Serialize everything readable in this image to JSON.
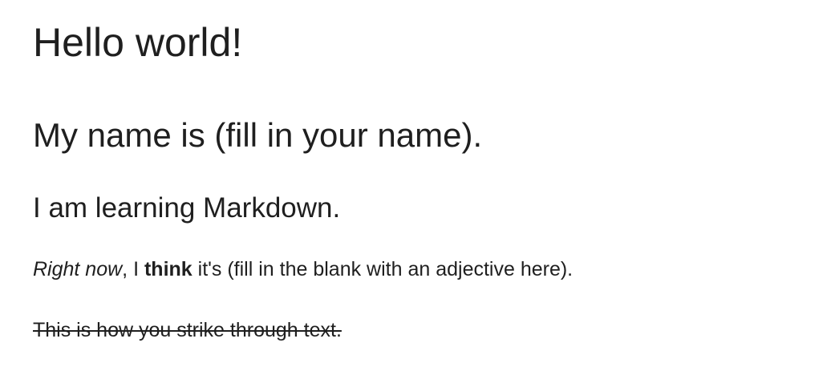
{
  "document": {
    "heading1": "Hello world!",
    "heading2": "My name is (fill in your name).",
    "heading3": "I am learning Markdown.",
    "paragraph1": {
      "italic": "Right now",
      "after_italic": ", I ",
      "bold": "think",
      "rest": " it's (fill in the blank with an adjective here)."
    },
    "paragraph2": {
      "strikethrough": "This is how you strike through text."
    }
  }
}
